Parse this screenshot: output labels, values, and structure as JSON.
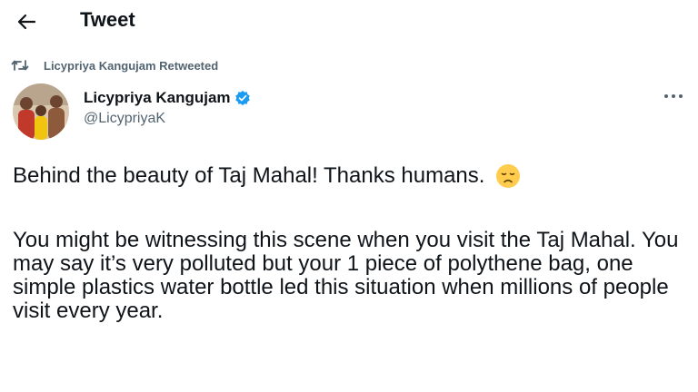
{
  "header": {
    "title": "Tweet"
  },
  "retweet": {
    "label": "Licypriya Kangujam Retweeted"
  },
  "author": {
    "name": "Licypriya Kangujam",
    "handle": "@LicypriyaK",
    "verified": true
  },
  "tweet": {
    "line1": "Behind the beauty of Taj Mahal! Thanks humans.",
    "emoji": "disappointed-face",
    "paragraph2": "You might be witnessing this scene when you visit the Taj Mahal. You may say it’s very polluted but your 1 piece of polythene bag, one simple plastics water bottle led this situation when millions of people visit every year."
  },
  "colors": {
    "text": "#0f1419",
    "secondary": "#536471",
    "verified_blue": "#1d9bf0"
  },
  "icons": {
    "back": "back-arrow-icon",
    "retweet": "retweet-icon",
    "verified": "verified-badge-icon",
    "more": "more-options-icon"
  }
}
